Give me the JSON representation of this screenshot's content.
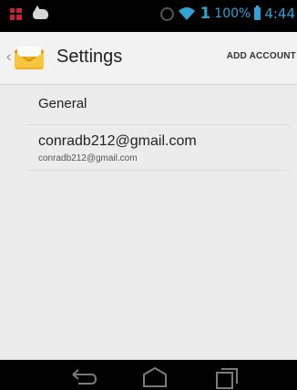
{
  "status_bar": {
    "signal_count": "1",
    "battery_percent": "100%",
    "time": "4:44",
    "icons": [
      "notification-grid-icon",
      "notification-cat-icon",
      "alarm-icon",
      "wifi-icon",
      "battery-icon"
    ]
  },
  "action_bar": {
    "title": "Settings",
    "add_account_label": "ADD ACCOUNT",
    "icons": [
      "up-chevron-icon",
      "email-app-icon"
    ]
  },
  "list": {
    "items": [
      {
        "title": "General"
      },
      {
        "title": "conradb212@gmail.com",
        "subtitle": "conradb212@gmail.com"
      }
    ]
  },
  "nav_bar": {
    "icons": [
      "back-icon",
      "home-icon",
      "recents-icon"
    ]
  },
  "colors": {
    "status_accent": "#2ea3d6",
    "status_background": "#000000",
    "content_background": "#ececec"
  }
}
